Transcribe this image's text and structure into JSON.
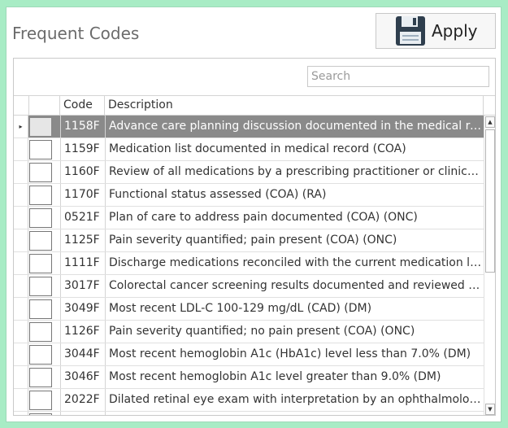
{
  "header": {
    "title": "Frequent Codes",
    "apply_label": "Apply",
    "apply_icon": "floppy-disk-icon"
  },
  "search": {
    "placeholder": "Search",
    "value": ""
  },
  "columns": {
    "code": "Code",
    "description": "Description"
  },
  "row_indicator": "▸",
  "rows": [
    {
      "code": "1158F",
      "description": "Advance care planning discussion documented in the medical record (COA)",
      "selected": true
    },
    {
      "code": "1159F",
      "description": "Medication list documented in medical record (COA)"
    },
    {
      "code": "1160F",
      "description": "Review of all medications by a prescribing practitioner or clinical pharmacist (COA)"
    },
    {
      "code": "1170F",
      "description": "Functional status assessed (COA) (RA)"
    },
    {
      "code": "0521F",
      "description": "Plan of care to address pain documented (COA) (ONC)"
    },
    {
      "code": "1125F",
      "description": "Pain severity quantified; pain present (COA) (ONC)"
    },
    {
      "code": "1111F",
      "description": "Discharge medications reconciled with the current medication list (COA)"
    },
    {
      "code": "3017F",
      "description": "Colorectal cancer screening results documented and reviewed (PV)"
    },
    {
      "code": "3049F",
      "description": "Most recent LDL-C 100-129 mg/dL (CAD) (DM)"
    },
    {
      "code": "1126F",
      "description": "Pain severity quantified; no pain present (COA) (ONC)"
    },
    {
      "code": "3044F",
      "description": "Most recent hemoglobin A1c (HbA1c) level less than 7.0% (DM)"
    },
    {
      "code": "3046F",
      "description": "Most recent hemoglobin A1c level greater than 9.0% (DM)"
    },
    {
      "code": "2022F",
      "description": "Dilated retinal eye exam with interpretation by an ophthalmologist or optometrist (DM)"
    },
    {
      "code": "",
      "description": ""
    }
  ],
  "scrollbar": {
    "up_arrow": "▲",
    "down_arrow": "▼"
  },
  "colors": {
    "background": "#a8ecc5",
    "selected_row": "#8a8a8a"
  }
}
